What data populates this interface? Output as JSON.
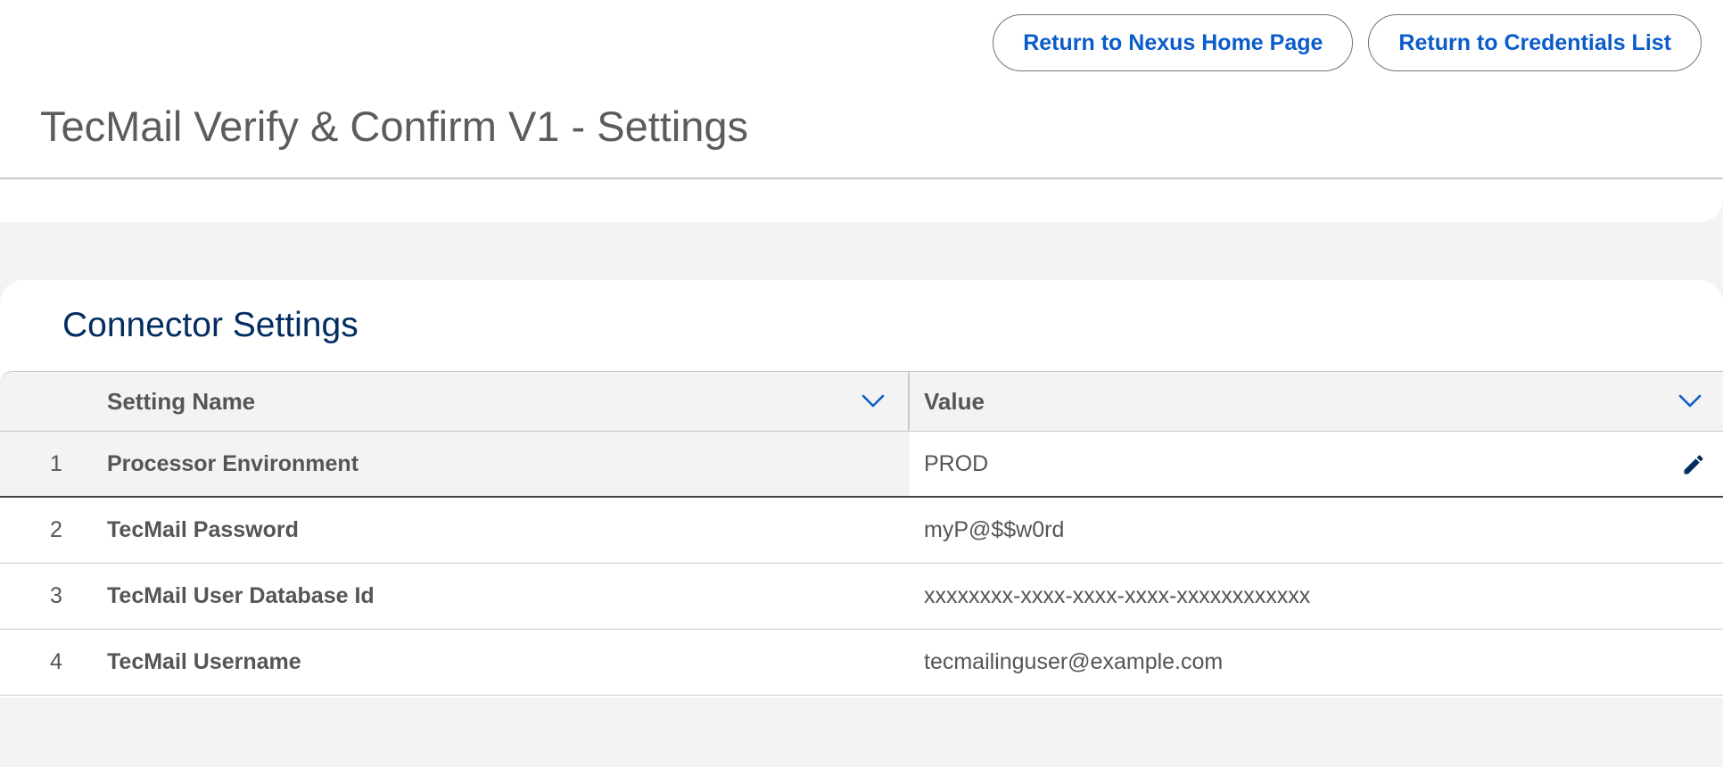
{
  "header": {
    "title": "TecMail Verify & Confirm V1 - Settings",
    "buttons": {
      "home": "Return to Nexus Home Page",
      "credentials": "Return to Credentials List"
    }
  },
  "connector": {
    "title": "Connector Settings",
    "columns": {
      "name": "Setting Name",
      "value": "Value"
    },
    "rows": [
      {
        "num": "1",
        "name": "Processor Environment",
        "value": "PROD"
      },
      {
        "num": "2",
        "name": "TecMail Password",
        "value": "myP@$$w0rd"
      },
      {
        "num": "3",
        "name": "TecMail User Database Id",
        "value": "xxxxxxxx-xxxx-xxxx-xxxx-xxxxxxxxxxxx"
      },
      {
        "num": "4",
        "name": "TecMail Username",
        "value": "tecmailinguser@example.com"
      }
    ]
  },
  "icons": {
    "column_sort": "chevron-down-icon",
    "edit": "pencil-icon"
  },
  "colors": {
    "accent": "#0b5cca",
    "section_title": "#032d60",
    "page_bg": "#f3f3f3"
  }
}
